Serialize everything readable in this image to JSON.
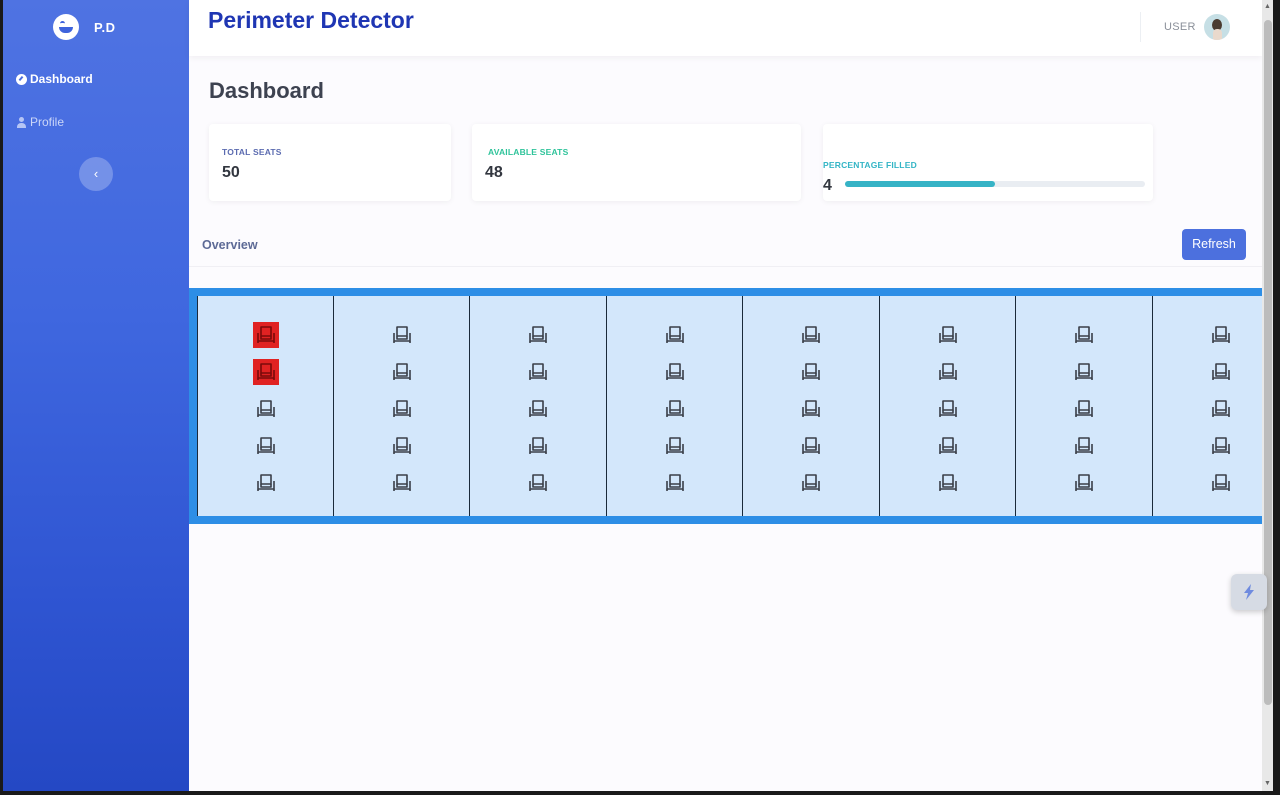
{
  "brand": {
    "name": "P.D"
  },
  "sidebar": {
    "items": [
      {
        "label": "Dashboard",
        "icon": "dashboard-icon",
        "active": true
      },
      {
        "label": "Profile",
        "icon": "user-icon",
        "active": false
      }
    ],
    "collapse_icon": "chevron-left-icon"
  },
  "header": {
    "title": "Perimeter Detector",
    "user_label": "USER"
  },
  "page": {
    "title": "Dashboard"
  },
  "stats": {
    "total_seats": {
      "label": "TOTAL SEATS",
      "value": "50"
    },
    "available_seats": {
      "label": "AVAILABLE SEATS",
      "value": "48"
    },
    "percentage_filled": {
      "label": "PERCENTAGE FILLED",
      "value": "4",
      "progress_fraction": 0.5
    }
  },
  "overview": {
    "title": "Overview",
    "refresh_label": "Refresh"
  },
  "seat_map": {
    "rows_per_column": 5,
    "columns": [
      {
        "seats": [
          "occupied",
          "occupied",
          "free",
          "free",
          "free"
        ]
      },
      {
        "seats": [
          "free",
          "free",
          "free",
          "free",
          "free"
        ]
      },
      {
        "seats": [
          "free",
          "free",
          "free",
          "free",
          "free"
        ]
      },
      {
        "seats": [
          "free",
          "free",
          "free",
          "free",
          "free"
        ]
      },
      {
        "seats": [
          "free",
          "free",
          "free",
          "free",
          "free"
        ]
      },
      {
        "seats": [
          "free",
          "free",
          "free",
          "free",
          "free"
        ]
      },
      {
        "seats": [
          "free",
          "free",
          "free",
          "free",
          "free"
        ]
      },
      {
        "seats": [
          "free",
          "free",
          "free",
          "free",
          "free"
        ]
      }
    ],
    "colors": {
      "occupied": "#e02222",
      "free": "#d3e7fb",
      "frame": "#2d8ee6"
    }
  },
  "colors": {
    "sidebar_top": "#4f73e2",
    "sidebar_bottom": "#2448c4",
    "title": "#1f36b3",
    "accent_button": "#4c70de",
    "progress": "#36b3c6"
  }
}
